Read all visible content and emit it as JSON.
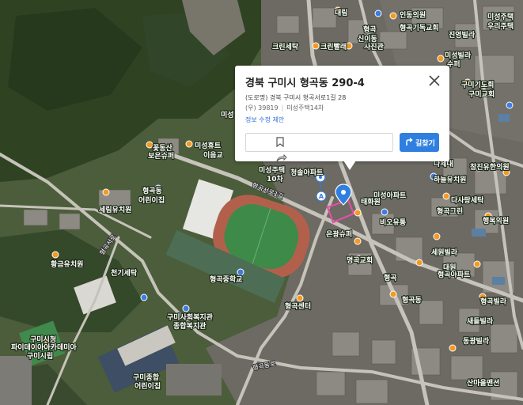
{
  "popup": {
    "title": "경북 구미시 형곡동 290-4",
    "road_address": "(도로명) 경북 구미시 형곡서로1길 28",
    "postal_code": "(우) 39819",
    "place_name": "미성주택14차",
    "edit_link": "정보 수정 제안",
    "route_button": "길찾기",
    "close_icon": "close-icon",
    "bookmark_icon": "bookmark-icon",
    "share_icon": "share-icon",
    "route_icon": "route-icon"
  },
  "markers": {
    "selected": {
      "letter": "A",
      "icon": "blue-location-pin"
    }
  },
  "map_labels": {
    "l01": "대림",
    "l02": "인동의원",
    "l03": "크린세탁",
    "l04": "형곡",
    "l05": "크린빨래",
    "l06": "형곡기독교회",
    "l07": "신이동",
    "l08": "사진관",
    "l09": "진영빌라",
    "l10": "미성빌라",
    "l11": "미성주택",
    "l12": "우리주택",
    "l13": "수퍼",
    "l14": "구미기도회",
    "l15": "구미교회",
    "l16": "미성",
    "l17": "미성휴트",
    "l18": "이음교",
    "l19": "보은슈퍼",
    "l20": "꽃동산",
    "l21": "형곡동",
    "l22": "어린이집",
    "l23": "미성주택",
    "l24": "10차",
    "l25": "청솔아파트",
    "l26": "세림유치원",
    "l27": "다세대",
    "l28": "하늘유치원",
    "l29": "참진유한의원",
    "l30": "다사랑세탁",
    "l31": "미성아파트",
    "l32": "형곡그린",
    "l33": "행복의원",
    "l34": "태화원",
    "l35": "비오유통",
    "l36": "은광슈퍼",
    "l37": "황금유치원",
    "l38": "명곡교회",
    "l39": "형곡중학교",
    "l40": "천기세탁",
    "l41": "형곡",
    "l42": "형곡동",
    "l43": "형곡센터",
    "l44": "구미사회복지관",
    "l45": "종합복지관",
    "l46": "구미시청",
    "l47": "형곡아파트",
    "l48": "파이데이아아카데미아",
    "l49": "구미시립",
    "l50": "구미종합",
    "l51": "어린이집",
    "l52": "새들빌라",
    "l53": "동광빌라",
    "l54": "산마을맨션",
    "l55": "대원",
    "l56": "형곡빌라",
    "l57": "세원빌라",
    "l58": "형곡서로",
    "l59": "형곡서로1길",
    "l60": "형곡동로"
  }
}
